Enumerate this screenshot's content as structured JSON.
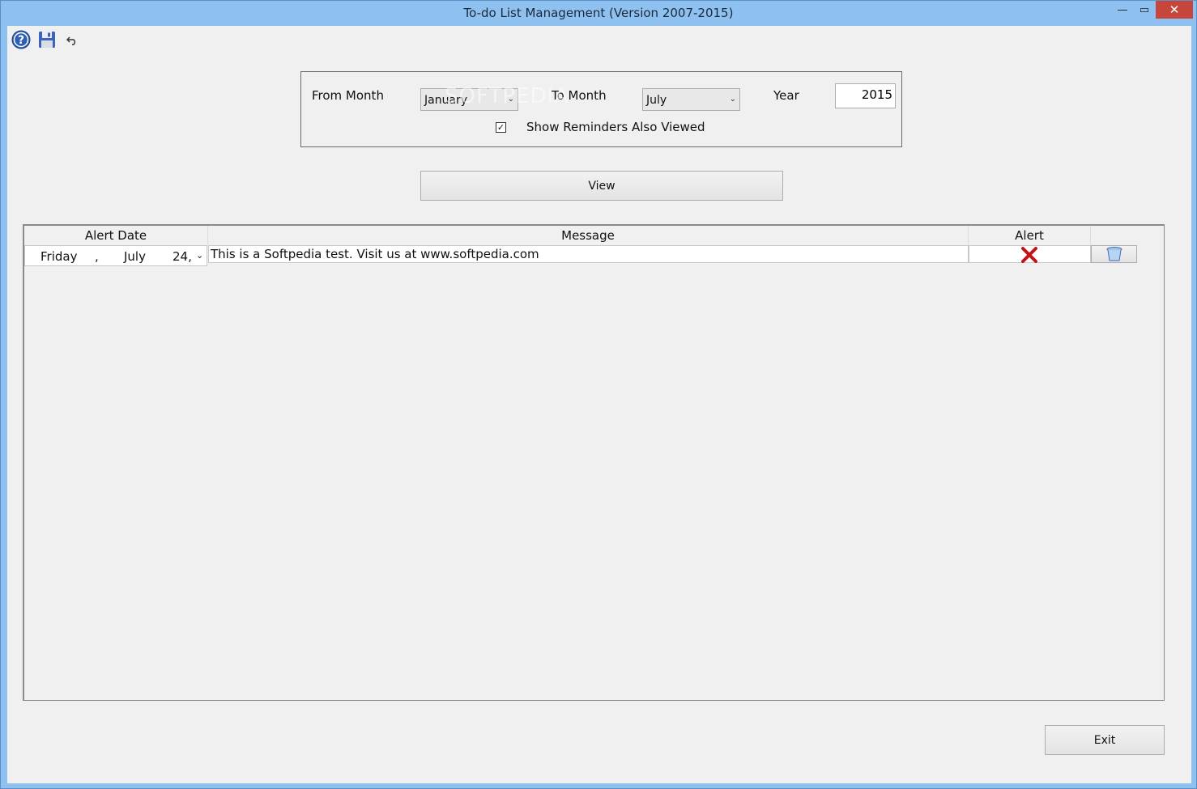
{
  "window": {
    "title": "To-do List Management (Version 2007-2015)",
    "minimize_glyph": "—",
    "maximize_glyph": "▭",
    "close_glyph": "✕"
  },
  "toolbar": {
    "icons": [
      "help-icon",
      "save-icon",
      "undo-icon"
    ]
  },
  "filter": {
    "from_month_label": "From Month",
    "from_month_value": "January",
    "to_month_label": "To Month",
    "to_month_value": "July",
    "year_label": "Year",
    "year_value": "2015",
    "show_reminders_label": "Show Reminders Also Viewed",
    "show_reminders_checked": "✓"
  },
  "watermark": "SOFTPEDIA",
  "view_button": "View",
  "grid": {
    "columns": [
      "Alert Date",
      "Message",
      "Alert"
    ],
    "rows": [
      {
        "date_day": "Friday",
        "date_comma": ",",
        "date_month": "July",
        "date_num": "24,",
        "message": "This is a Softpedia test. Visit us at www.softpedia.com",
        "alert_icon": "red-x-icon",
        "delete_icon": "trash-icon"
      }
    ]
  },
  "exit_button": "Exit",
  "colors": {
    "titlebar": "#8ec1ef",
    "close_button": "#c7463c",
    "client_bg": "#f0f0f0",
    "alert_x": "#c0141a"
  }
}
